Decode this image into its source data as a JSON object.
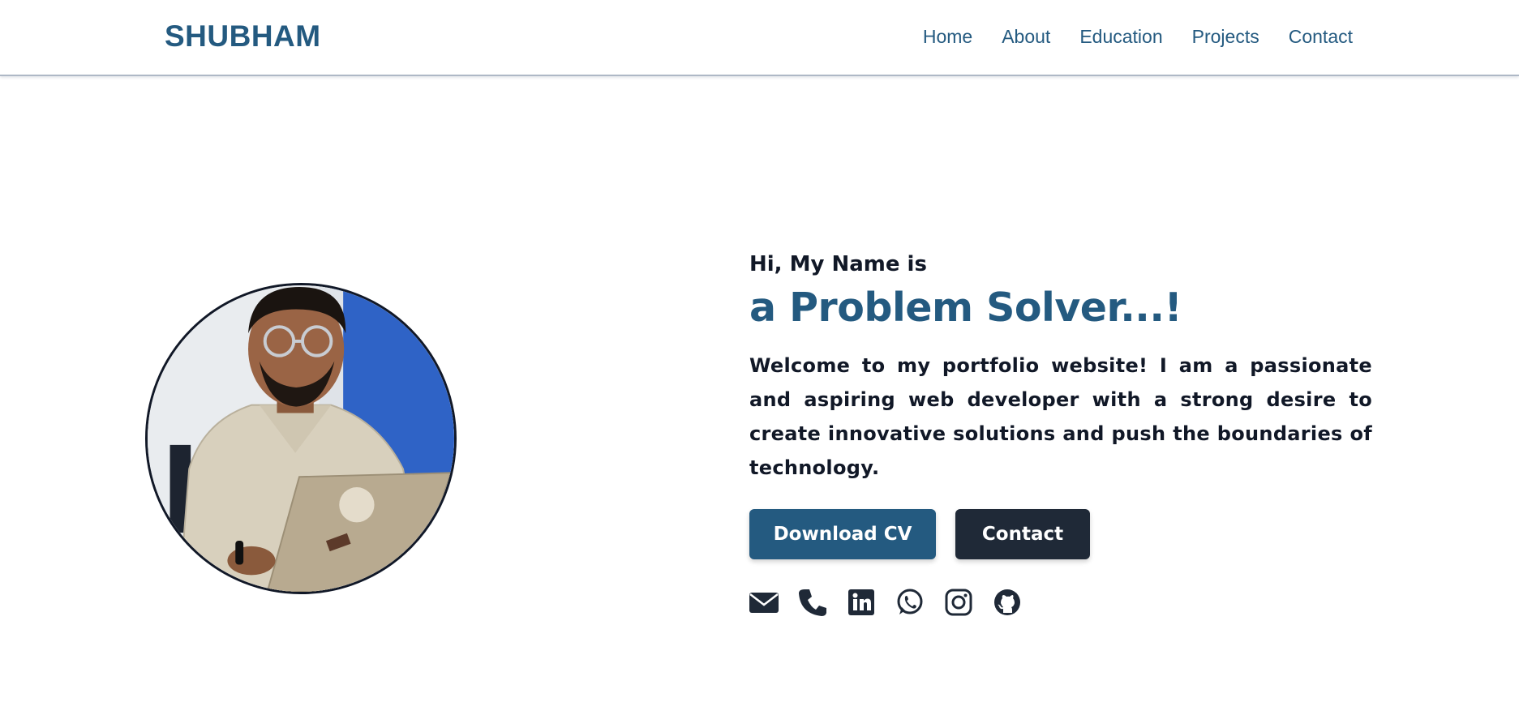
{
  "navbar": {
    "brand": "SHUBHAM",
    "links": [
      "Home",
      "About",
      "Education",
      "Projects",
      "Contact"
    ]
  },
  "hero": {
    "greeting": "Hi, My Name is",
    "headline": "a Problem Solver...!",
    "intro": "Welcome to my portfolio website! I am a passionate and aspiring web developer with a strong desire to create innovative solutions and push the boundaries of technology.",
    "buttons": {
      "download_cv": "Download CV",
      "contact": "Contact"
    },
    "socials": [
      "email-icon",
      "phone-icon",
      "linkedin-icon",
      "whatsapp-icon",
      "instagram-icon",
      "github-icon"
    ]
  },
  "colors": {
    "brand": "#245a80",
    "dark": "#1f2937",
    "text": "#111827"
  }
}
